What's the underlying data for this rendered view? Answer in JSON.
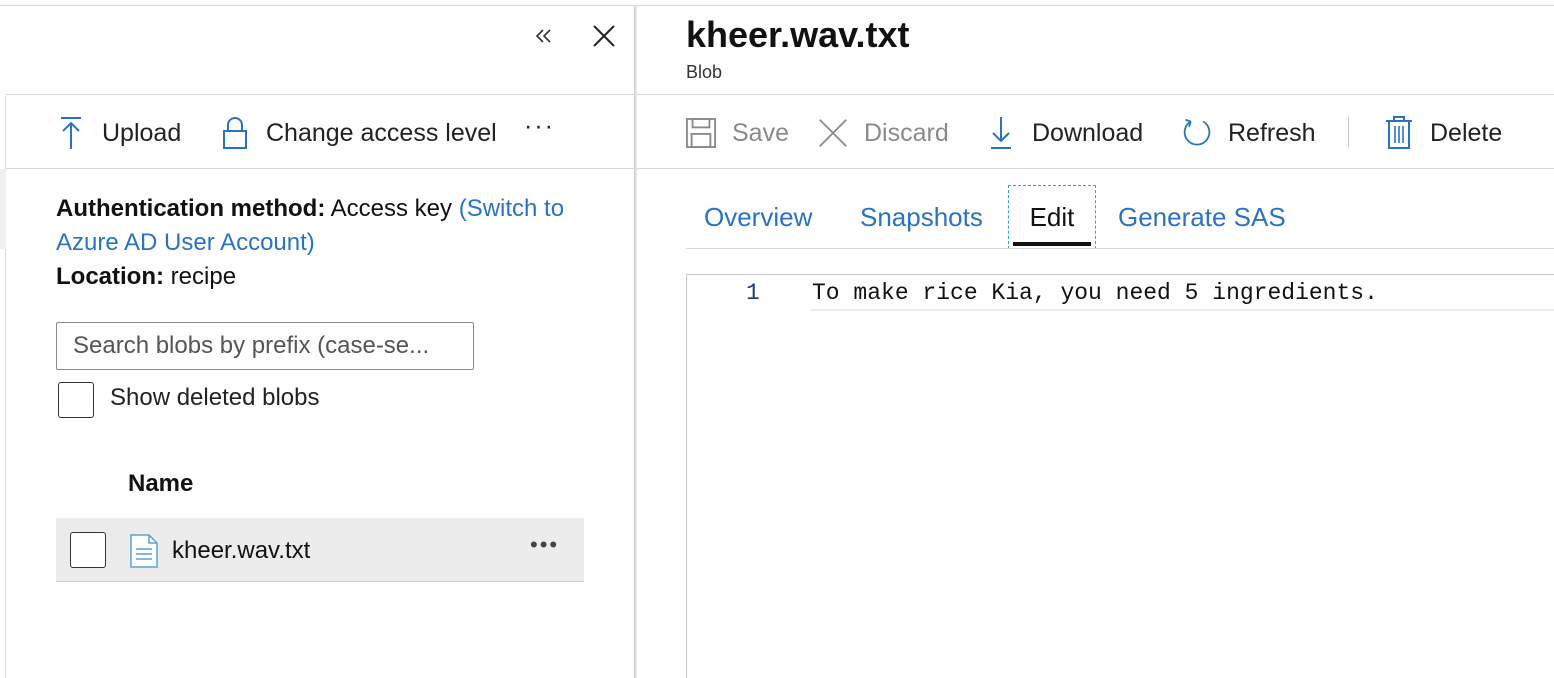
{
  "left_panel": {
    "toolbar": {
      "upload_label": "Upload",
      "change_access_label": "Change access level",
      "more_label": "···"
    },
    "auth": {
      "method_label": "Authentication method:",
      "method_value": "Access key",
      "switch_link": "(Switch to Azure AD User Account)",
      "location_label": "Location:",
      "location_value": "recipe"
    },
    "search": {
      "placeholder": "Search blobs by prefix (case-se...",
      "value": ""
    },
    "show_deleted_label": "Show deleted blobs",
    "table": {
      "column_name": "Name",
      "rows": [
        {
          "name": "kheer.wav.txt",
          "icon": "document-icon",
          "more": "•••"
        }
      ]
    }
  },
  "blob": {
    "title": "kheer.wav.txt",
    "subtitle": "Blob"
  },
  "right_toolbar": {
    "save_label": "Save",
    "discard_label": "Discard",
    "download_label": "Download",
    "refresh_label": "Refresh",
    "delete_label": "Delete"
  },
  "tabs": [
    {
      "label": "Overview",
      "active": false
    },
    {
      "label": "Snapshots",
      "active": false
    },
    {
      "label": "Edit",
      "active": true
    },
    {
      "label": "Generate SAS",
      "active": false
    }
  ],
  "editor": {
    "line_number": "1",
    "line_text": "To make rice Kia, you need 5 ingredients."
  },
  "colors": {
    "link": "#2a73c4",
    "accent_focus": "#2aa3d8",
    "row_selected": "#ececec"
  }
}
